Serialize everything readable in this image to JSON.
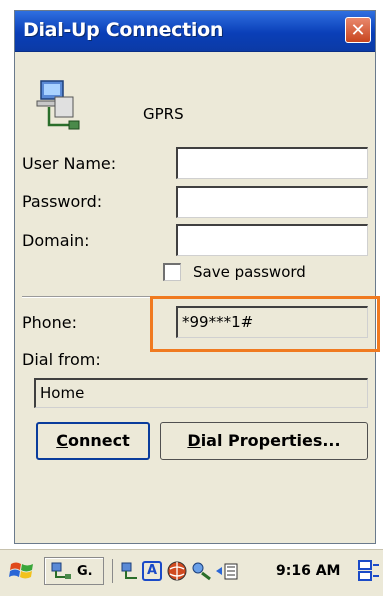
{
  "window": {
    "title": "Dial-Up Connection",
    "close_label": "✕",
    "connection_icon": "network-connection-icon",
    "connection_name": "GPRS"
  },
  "form": {
    "user_name_label": "User Name:",
    "user_name_value": "",
    "password_label": "Password:",
    "password_value": "",
    "domain_label": "Domain:",
    "domain_value": "",
    "save_password_label": "Save password",
    "save_password_checked": false,
    "phone_label": "Phone:",
    "phone_value": "*99***1#",
    "dial_from_label": "Dial from:",
    "dial_from_value": "Home"
  },
  "buttons": {
    "connect": {
      "label_underlined": "C",
      "label_rest": "onnect"
    },
    "dial_properties": {
      "label_underlined": "D",
      "label_rest": "ial Properties..."
    }
  },
  "taskbar": {
    "start_icon": "windows-flag-icon",
    "app1_label": "G.",
    "input_icon_letter": "A",
    "clock": "9:16 AM"
  },
  "colors": {
    "title_bar": "#0a3fb8",
    "highlight_box": "#f07a20",
    "window_bg": "#ece9d8"
  }
}
